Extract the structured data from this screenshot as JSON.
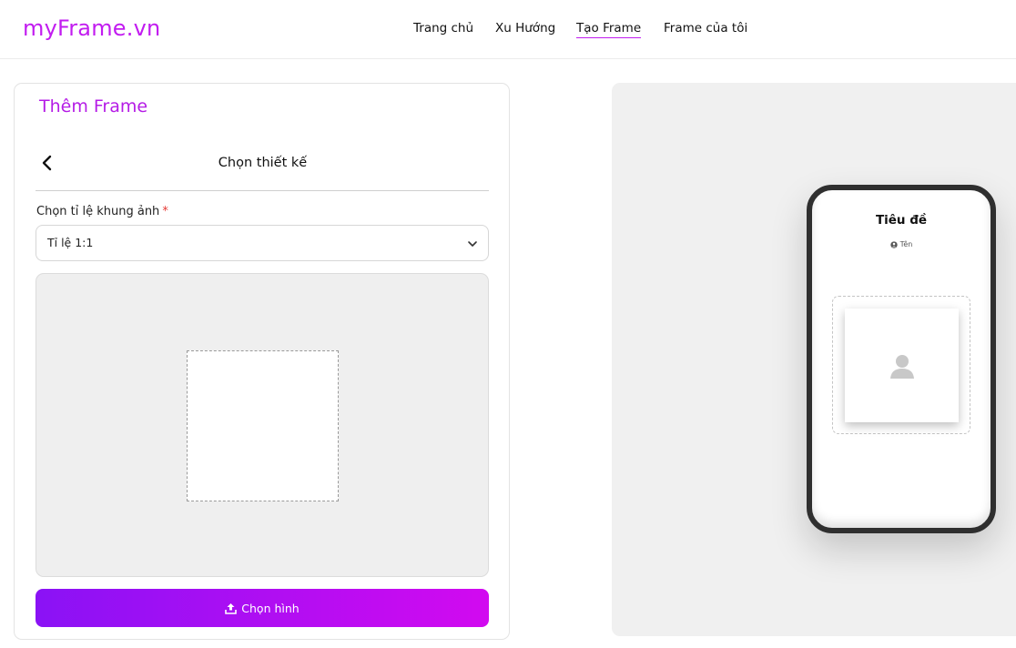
{
  "brand": {
    "logo": "myFrame.vn",
    "accent": "#c21cf0"
  },
  "nav": {
    "items": [
      {
        "label": "Trang chủ",
        "active": false
      },
      {
        "label": "Xu Hướng",
        "active": false
      },
      {
        "label": "Tạo Frame",
        "active": true
      },
      {
        "label": "Frame của tôi",
        "active": false
      }
    ]
  },
  "form": {
    "card_title": "Thêm Frame",
    "step_title": "Chọn thiết kế",
    "ratio_label": "Chọn tỉ lệ khung ảnh",
    "required_mark": "*",
    "ratio_selected": "Tỉ lệ 1:1",
    "upload_label": "Chọn hình"
  },
  "preview": {
    "title": "Tiêu đề",
    "author": "Tên"
  },
  "icons": {
    "back": "chevron-left-icon",
    "caret": "chevron-down-icon",
    "upload": "upload-icon",
    "author": "user-circle-icon",
    "placeholder": "user-silhouette-icon"
  },
  "colors": {
    "button_gradient_start": "#8a12f5",
    "button_gradient_end": "#d20af0",
    "title_purple": "#b51ce6"
  }
}
